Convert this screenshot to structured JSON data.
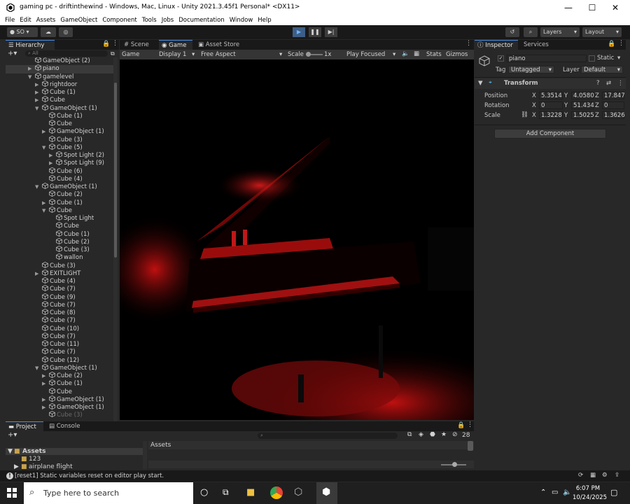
{
  "window": {
    "title": "gaming pc - driftinthewind - Windows, Mac, Linux - Unity 2021.3.45f1 Personal* <DX11>",
    "minimize": "—",
    "maximize": "☐",
    "close": "✕"
  },
  "menu": [
    "File",
    "Edit",
    "Assets",
    "GameObject",
    "Component",
    "Tools",
    "Jobs",
    "Documentation",
    "Window",
    "Help"
  ],
  "toolbar": {
    "account": "SO",
    "layers": "Layers",
    "layout": "Layout"
  },
  "hierarchy": {
    "tab": "Hierarchy",
    "search_placeholder": "All",
    "items": [
      {
        "label": "GameObject (2)",
        "indent": 1,
        "arrow": ""
      },
      {
        "label": "piano",
        "indent": 1,
        "arrow": "▶",
        "selected": true
      },
      {
        "label": "gamelevel",
        "indent": 1,
        "arrow": "▼"
      },
      {
        "label": "rightdoor",
        "indent": 2,
        "arrow": "▶"
      },
      {
        "label": "Cube (1)",
        "indent": 2,
        "arrow": "▶"
      },
      {
        "label": "Cube",
        "indent": 2,
        "arrow": "▶"
      },
      {
        "label": "GameObject (1)",
        "indent": 2,
        "arrow": "▼"
      },
      {
        "label": "Cube (1)",
        "indent": 3,
        "arrow": ""
      },
      {
        "label": "Cube",
        "indent": 3,
        "arrow": ""
      },
      {
        "label": "GameObject (1)",
        "indent": 3,
        "arrow": "▶"
      },
      {
        "label": "Cube (3)",
        "indent": 3,
        "arrow": ""
      },
      {
        "label": "Cube (5)",
        "indent": 3,
        "arrow": "▼"
      },
      {
        "label": "Spot Light (2)",
        "indent": 4,
        "arrow": "▶"
      },
      {
        "label": "Spot Light (9)",
        "indent": 4,
        "arrow": "▶"
      },
      {
        "label": "Cube (6)",
        "indent": 3,
        "arrow": ""
      },
      {
        "label": "Cube (4)",
        "indent": 3,
        "arrow": ""
      },
      {
        "label": "GameObject (1)",
        "indent": 2,
        "arrow": "▼"
      },
      {
        "label": "Cube (2)",
        "indent": 3,
        "arrow": ""
      },
      {
        "label": "Cube (1)",
        "indent": 3,
        "arrow": "▶"
      },
      {
        "label": "Cube",
        "indent": 3,
        "arrow": "▼"
      },
      {
        "label": "Spot Light",
        "indent": 4,
        "arrow": ""
      },
      {
        "label": "Cube",
        "indent": 4,
        "arrow": ""
      },
      {
        "label": "Cube (1)",
        "indent": 4,
        "arrow": ""
      },
      {
        "label": "Cube (2)",
        "indent": 4,
        "arrow": ""
      },
      {
        "label": "Cube (3)",
        "indent": 4,
        "arrow": ""
      },
      {
        "label": "wallon",
        "indent": 4,
        "arrow": ""
      },
      {
        "label": "Cube (3)",
        "indent": 2,
        "arrow": ""
      },
      {
        "label": "EXITLIGHT",
        "indent": 2,
        "arrow": "▶"
      },
      {
        "label": "Cube (4)",
        "indent": 2,
        "arrow": ""
      },
      {
        "label": "Cube (7)",
        "indent": 2,
        "arrow": ""
      },
      {
        "label": "Cube (9)",
        "indent": 2,
        "arrow": ""
      },
      {
        "label": "Cube (7)",
        "indent": 2,
        "arrow": ""
      },
      {
        "label": "Cube (8)",
        "indent": 2,
        "arrow": ""
      },
      {
        "label": "Cube (7)",
        "indent": 2,
        "arrow": ""
      },
      {
        "label": "Cube (10)",
        "indent": 2,
        "arrow": ""
      },
      {
        "label": "Cube (7)",
        "indent": 2,
        "arrow": ""
      },
      {
        "label": "Cube (11)",
        "indent": 2,
        "arrow": ""
      },
      {
        "label": "Cube (7)",
        "indent": 2,
        "arrow": ""
      },
      {
        "label": "Cube (12)",
        "indent": 2,
        "arrow": ""
      },
      {
        "label": "GameObject (1)",
        "indent": 2,
        "arrow": "▼"
      },
      {
        "label": "Cube (2)",
        "indent": 3,
        "arrow": "▶"
      },
      {
        "label": "Cube (1)",
        "indent": 3,
        "arrow": "▶"
      },
      {
        "label": "Cube",
        "indent": 3,
        "arrow": ""
      },
      {
        "label": "GameObject (1)",
        "indent": 3,
        "arrow": "▶"
      },
      {
        "label": "GameObject (1)",
        "indent": 3,
        "arrow": "▶"
      },
      {
        "label": "Cube (3)",
        "indent": 3,
        "arrow": "",
        "dim": true
      }
    ]
  },
  "scene_tabs": {
    "scene": "Scene",
    "game": "Game",
    "asset_store": "Asset Store"
  },
  "game_toolbar": {
    "mode": "Game",
    "display": "Display 1",
    "aspect": "Free Aspect",
    "scale_label": "Scale",
    "scale_value": "1x",
    "play_focused": "Play Focused",
    "stats": "Stats",
    "gizmos": "Gizmos"
  },
  "inspector": {
    "tab": "Inspector",
    "services_tab": "Services",
    "object_name": "piano",
    "static_label": "Static",
    "tag_label": "Tag",
    "tag_value": "Untagged",
    "layer_label": "Layer",
    "layer_value": "Default",
    "transform": {
      "title": "Transform",
      "position_label": "Position",
      "rotation_label": "Rotation",
      "scale_label": "Scale",
      "position": {
        "x": "5.3514",
        "y": "4.0580",
        "z": "17.847"
      },
      "rotation": {
        "x": "0",
        "y": "51.434",
        "z": "0"
      },
      "scale": {
        "x": "1.3228",
        "y": "1.5025",
        "z": "1.3626"
      }
    },
    "add_component": "Add Component"
  },
  "bottom": {
    "project_tab": "Project",
    "console_tab": "Console",
    "assets_root": "Assets",
    "assets_header": "Assets",
    "folders": [
      "123",
      "airplane flight"
    ],
    "count": "28"
  },
  "status": {
    "message": "[reset1] Static variables reset on editor play start."
  },
  "taskbar": {
    "search": "Type here to search",
    "time": "6:07 PM",
    "date": "10/24/2025"
  }
}
